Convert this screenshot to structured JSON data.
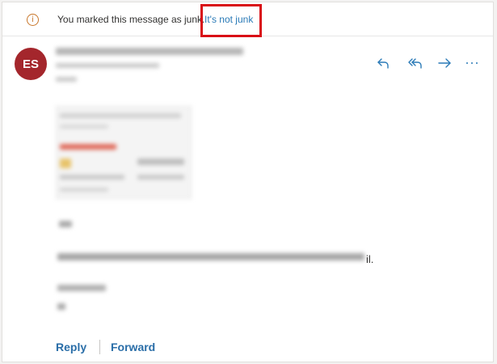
{
  "infobar": {
    "icon": "info-icon",
    "message": "You marked this message as junk.",
    "link_label": "It's not junk"
  },
  "sender": {
    "initials": "ES",
    "avatar_color": "#a4262c"
  },
  "actions": {
    "reply_icon": "reply-icon",
    "reply_all_icon": "reply-all-icon",
    "forward_icon": "forward-icon",
    "more_icon": "more-icon"
  },
  "body": {
    "visible_tail": "il."
  },
  "footer": {
    "reply_label": "Reply",
    "forward_label": "Forward"
  },
  "colors": {
    "accent": "#2a7ab7",
    "highlight_box": "#d90f16",
    "warning": "#c8762a"
  }
}
